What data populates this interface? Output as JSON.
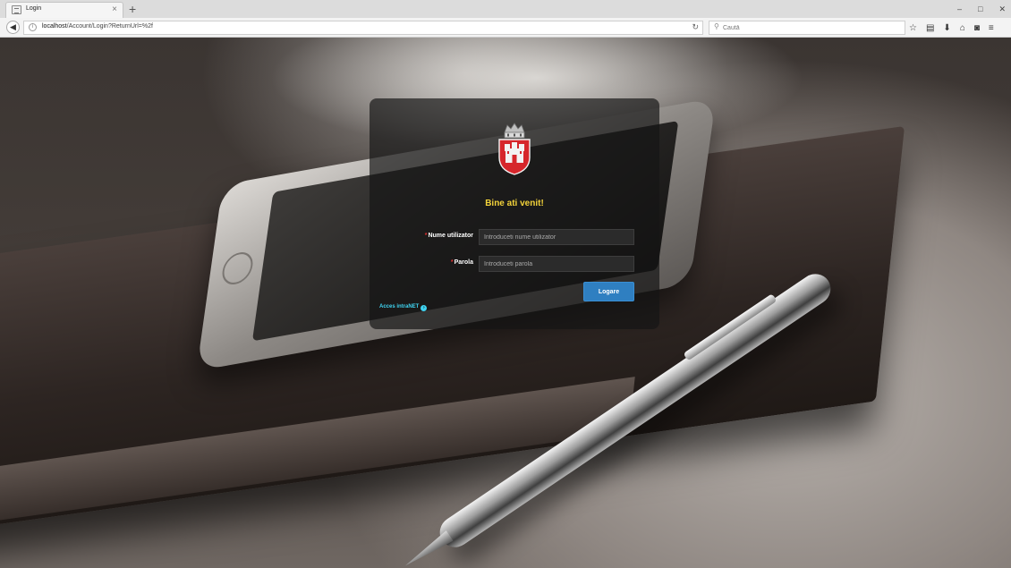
{
  "browser": {
    "tab_title": "Login",
    "tab_close": "×",
    "new_tab": "+",
    "window_controls": [
      "–",
      "□",
      "✕"
    ],
    "url_host": "localhost",
    "url_path": "/Account/Login?ReturnUrl=%2f",
    "search_placeholder": "Caută",
    "toolbar_icons": [
      "star-icon",
      "reading-list-icon",
      "download-icon",
      "home-icon",
      "pocket-icon",
      "menu-icon"
    ]
  },
  "login": {
    "welcome": "Bine ati venit!",
    "username_label": "Nume utilizator",
    "username_placeholder": "Introduceti nume utilizator",
    "password_label": "Parola",
    "password_placeholder": "Introduceti parola",
    "required_marker": "*",
    "submit_label": "Logare",
    "intranet_link": "Acces intraNET"
  },
  "colors": {
    "welcome_text": "#f2d23a",
    "submit_bg": "#2f7fc1",
    "link": "#3fd3f0",
    "required": "#e03030"
  }
}
